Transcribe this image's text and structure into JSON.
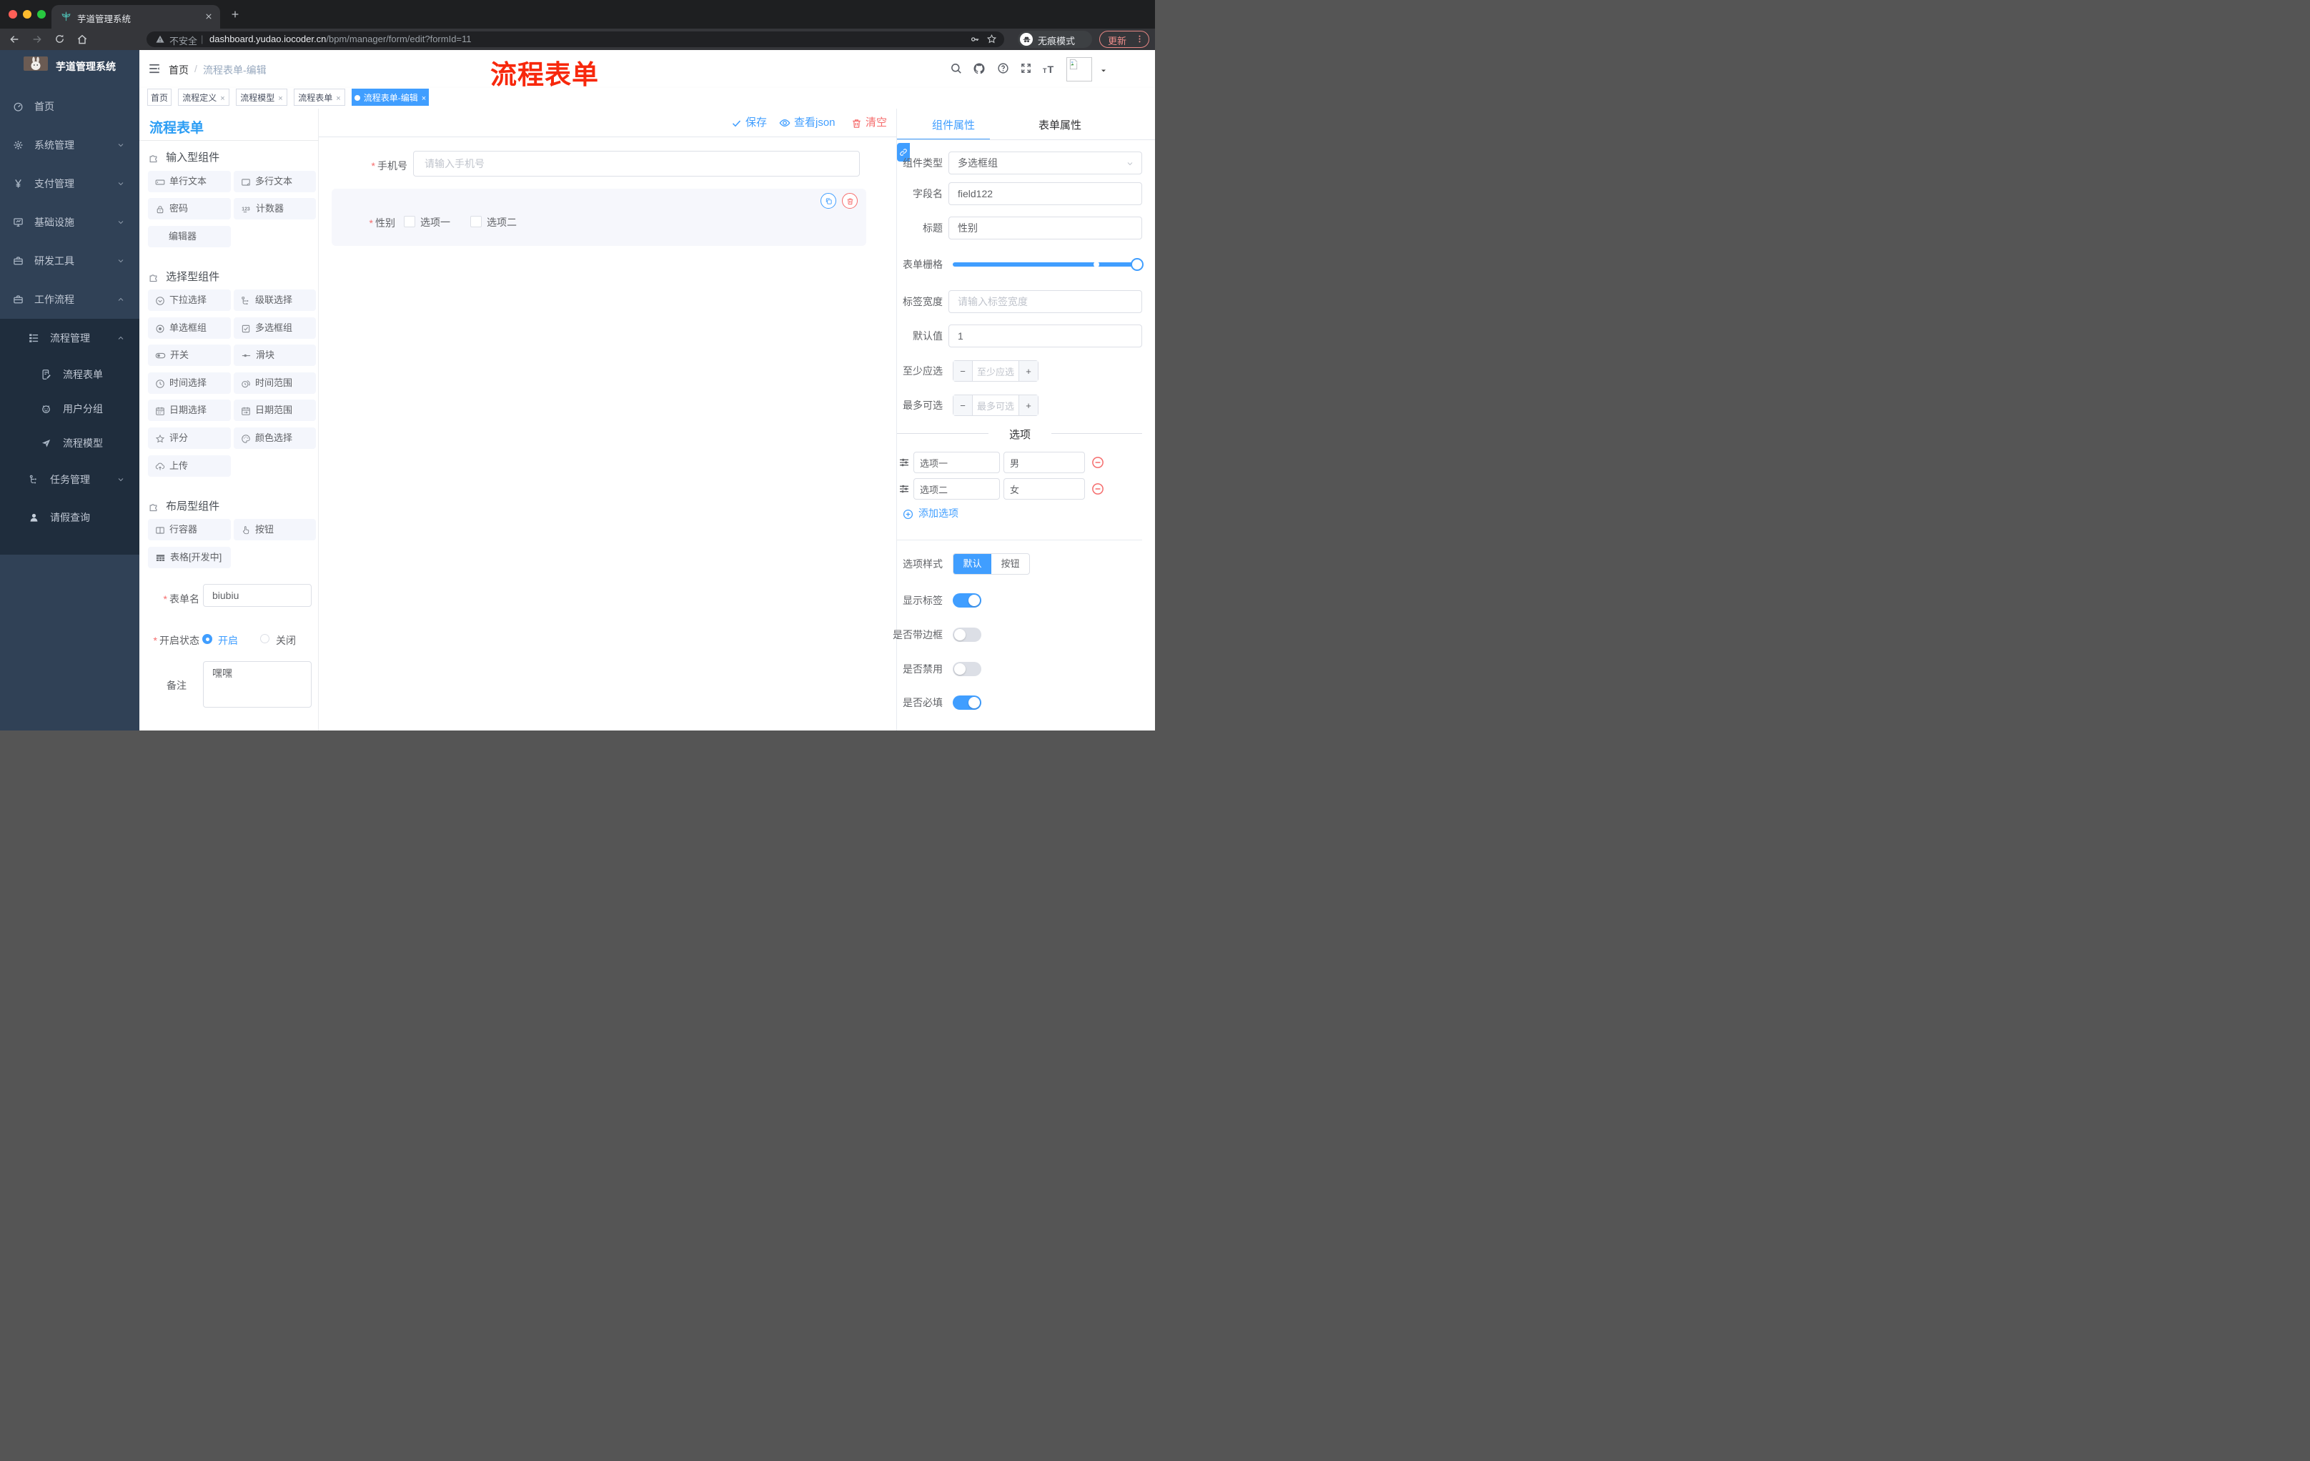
{
  "colors": {
    "accent": "#409EFF",
    "danger": "#F56C6C",
    "panel_title_blue": "#2B9DF4",
    "annotation_red": "#F7280C",
    "sidebar_bg": "#304156",
    "submenu_bg": "#1F2D3D"
  },
  "browser": {
    "tab_title": "芋道管理系统",
    "security_label": "不安全",
    "url_host": "dashboard.yudao.iocoder.cn",
    "url_path": "/bpm/manager/form/edit?formId=11",
    "incognito_label": "无痕模式",
    "update_label": "更新"
  },
  "annotation": {
    "text": "流程表单"
  },
  "sidebar": {
    "app_title": "芋道管理系统",
    "items": [
      {
        "label": "首页"
      },
      {
        "label": "系统管理"
      },
      {
        "label": "支付管理"
      },
      {
        "label": "基础设施"
      },
      {
        "label": "研发工具"
      },
      {
        "label": "工作流程"
      },
      {
        "label": "流程管理"
      },
      {
        "label": "流程表单"
      },
      {
        "label": "用户分组"
      },
      {
        "label": "流程模型"
      },
      {
        "label": "任务管理"
      },
      {
        "label": "请假查询"
      }
    ]
  },
  "header": {
    "breadcrumb": {
      "home": "首页",
      "separator": "/",
      "current": "流程表单-编辑"
    }
  },
  "tags": [
    {
      "label": "首页"
    },
    {
      "label": "流程定义"
    },
    {
      "label": "流程模型"
    },
    {
      "label": "流程表单"
    },
    {
      "label": "流程表单-编辑"
    }
  ],
  "palette": {
    "title": "流程表单",
    "sections": [
      {
        "title": "输入型组件",
        "items": [
          "单行文本",
          "多行文本",
          "密码",
          "计数器",
          "编辑器"
        ]
      },
      {
        "title": "选择型组件",
        "items": [
          "下拉选择",
          "级联选择",
          "单选框组",
          "多选框组",
          "开关",
          "滑块",
          "时间选择",
          "时间范围",
          "日期选择",
          "日期范围",
          "评分",
          "颜色选择",
          "上传"
        ]
      },
      {
        "title": "布局型组件",
        "items": [
          "行容器",
          "按钮",
          "表格[开发中]"
        ]
      }
    ]
  },
  "form_meta": {
    "name_label": "表单名",
    "name_value": "biubiu",
    "status_label": "开启状态",
    "status_on": "开启",
    "status_off": "关闭",
    "remark_label": "备注",
    "remark_value": "嘿嘿"
  },
  "toolbar": {
    "save": "保存",
    "view_json": "查看json",
    "clear": "清空"
  },
  "canvas": {
    "phone_label": "手机号",
    "phone_placeholder": "请输入手机号",
    "gender_label": "性别",
    "gender_option1": "选项一",
    "gender_option2": "选项二"
  },
  "props": {
    "tab_component": "组件属性",
    "tab_form": "表单属性",
    "type_label": "组件类型",
    "type_value": "多选框组",
    "field_label": "字段名",
    "field_value": "field122",
    "title_label": "标题",
    "title_value": "性别",
    "grid_label": "表单栅格",
    "label_width_label": "标签宽度",
    "label_width_placeholder": "请输入标签宽度",
    "default_label": "默认值",
    "default_value": "1",
    "min_label": "至少应选",
    "min_placeholder": "至少应选",
    "max_label": "最多可选",
    "max_placeholder": "最多可选",
    "options_title": "选项",
    "options": [
      {
        "label": "选项一",
        "value": "男"
      },
      {
        "label": "选项二",
        "value": "女"
      }
    ],
    "add_option": "添加选项",
    "style_label": "选项样式",
    "style_options": [
      "默认",
      "按钮"
    ],
    "toggle_show_label": "显示标签",
    "toggle_border": "是否带边框",
    "toggle_disabled": "是否禁用",
    "toggle_required": "是否必填"
  }
}
